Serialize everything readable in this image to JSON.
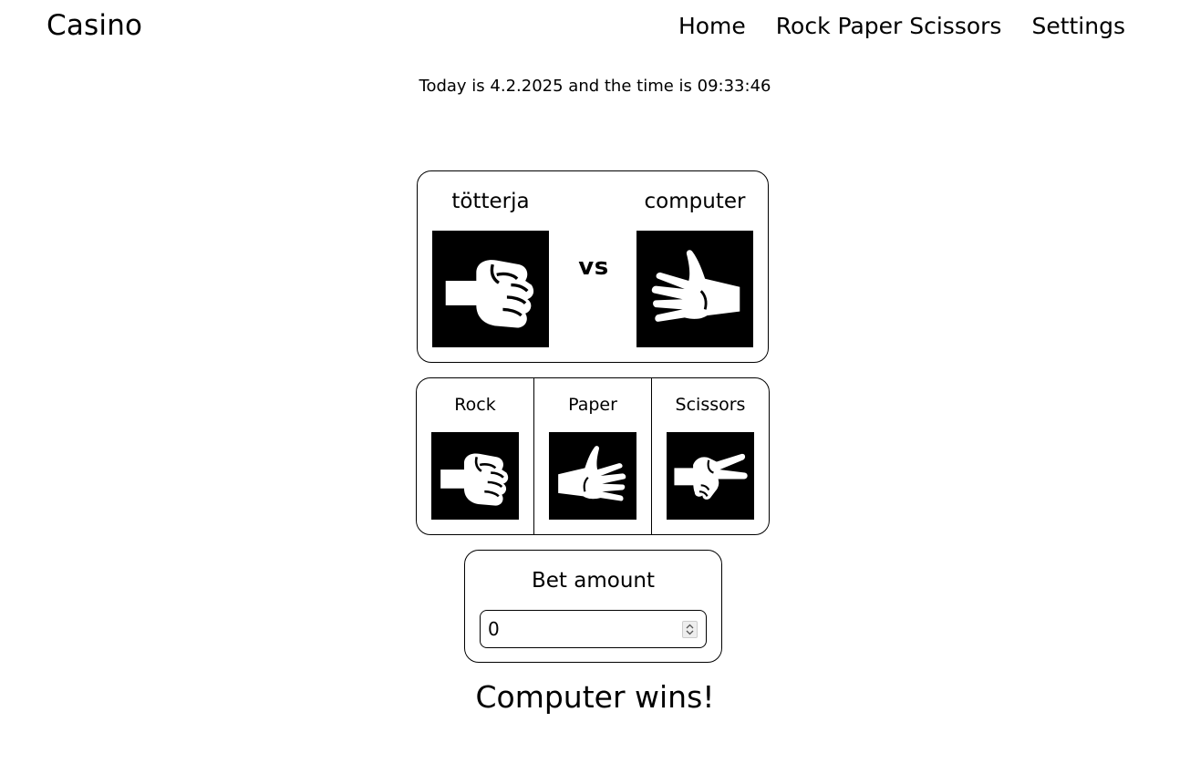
{
  "header": {
    "brand": "Casino",
    "nav": [
      "Home",
      "Rock Paper Scissors",
      "Settings"
    ]
  },
  "datetime": "Today is 4.2.2025 and the time is 09:33:46",
  "arena": {
    "player_name": "tötterja",
    "opponent_name": "computer",
    "vs_label": "vs",
    "player_hand": "rock-hand-icon",
    "opponent_hand": "paper-hand-icon"
  },
  "choices": [
    {
      "label": "Rock",
      "icon": "rock-hand-icon"
    },
    {
      "label": "Paper",
      "icon": "paper-hand-icon"
    },
    {
      "label": "Scissors",
      "icon": "scissors-hand-icon"
    }
  ],
  "bet": {
    "label": "Bet amount",
    "value": "0"
  },
  "result": "Computer wins!"
}
